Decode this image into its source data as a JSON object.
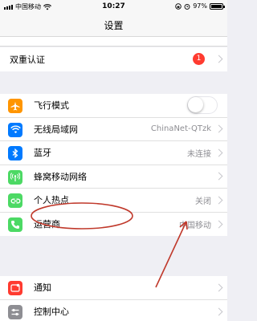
{
  "status_bar": {
    "carrier": "中国移动",
    "time": "10:27",
    "battery": "97%",
    "battery_level": 0.97
  },
  "nav": {
    "title": "设置"
  },
  "two_factor": {
    "label": "双重认证",
    "badge": "1"
  },
  "network_group": [
    {
      "key": "airplane",
      "label": "飞行模式",
      "value": "",
      "icon": "airplane-icon",
      "color": "#ff9500",
      "toggle": false
    },
    {
      "key": "wifi",
      "label": "无线局域网",
      "value": "ChinaNet-QTzk",
      "icon": "wifi-icon",
      "color": "#007aff"
    },
    {
      "key": "bluetooth",
      "label": "蓝牙",
      "value": "未连接",
      "icon": "bluetooth-icon",
      "color": "#007aff"
    },
    {
      "key": "cellular",
      "label": "蜂窝移动网络",
      "value": "",
      "icon": "antenna-icon",
      "color": "#4cd964"
    },
    {
      "key": "hotspot",
      "label": "个人热点",
      "value": "关闭",
      "icon": "hotspot-link-icon",
      "color": "#4cd964"
    },
    {
      "key": "carrier",
      "label": "运营商",
      "value": "中国移动",
      "icon": "phone-icon",
      "color": "#4cd964"
    }
  ],
  "notify_group": [
    {
      "key": "notifications",
      "label": "通知",
      "icon": "notification-icon",
      "color": "#ff3b30"
    },
    {
      "key": "control_center",
      "label": "控制中心",
      "icon": "sliders-icon",
      "color": "#8e8e93"
    }
  ],
  "annotation": {
    "color": "#c0392b"
  }
}
